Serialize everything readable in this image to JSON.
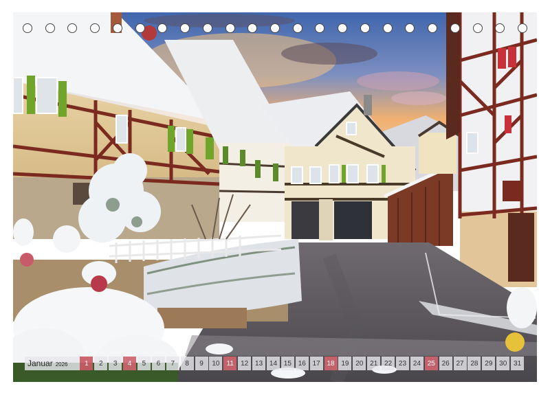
{
  "calendar": {
    "month": "Januar",
    "year": "2026",
    "days": [
      "1",
      "2",
      "3",
      "4",
      "5",
      "6",
      "7",
      "8",
      "9",
      "10",
      "11",
      "12",
      "13",
      "14",
      "15",
      "16",
      "17",
      "18",
      "19",
      "20",
      "21",
      "22",
      "23",
      "24",
      "25",
      "26",
      "27",
      "28",
      "29",
      "30",
      "31"
    ],
    "sunday_days": [
      "4",
      "11",
      "18",
      "25"
    ],
    "holiday_days": [
      "1"
    ],
    "binding_hole_count": 23
  },
  "colors": {
    "sunday_bg": "#cd646e",
    "sky_top": "#4a74b8",
    "sunset": "#f2a55a",
    "timber": "#7a2a1e",
    "shutter_green": "#6ea52a",
    "snow": "#f4f6f8"
  }
}
